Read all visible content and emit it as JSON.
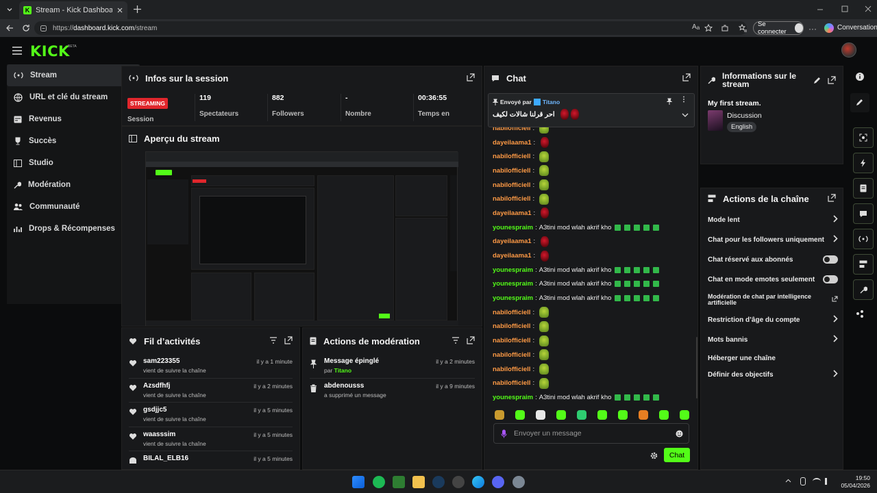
{
  "browser": {
    "tab_title": "Stream - Kick Dashboard",
    "url_scheme": "https://",
    "url_host": "dashboard.kick.com",
    "url_path": "/stream",
    "connect_label": "Se connecter",
    "conversation_label": "Conversation"
  },
  "brand": {
    "logo": "KICK",
    "tag": "BETA",
    "accent": "#53fc18"
  },
  "sidebar": {
    "items": [
      {
        "label": "Stream",
        "icon": "broadcast-icon"
      },
      {
        "label": "URL et clé du stream",
        "icon": "link-icon"
      },
      {
        "label": "Revenus",
        "icon": "wallet-icon"
      },
      {
        "label": "Succès",
        "icon": "trophy-icon"
      },
      {
        "label": "Studio",
        "icon": "studio-icon"
      },
      {
        "label": "Modération",
        "icon": "wrench-icon"
      },
      {
        "label": "Communauté",
        "icon": "community-icon"
      },
      {
        "label": "Drops & Récompenses",
        "icon": "chart-icon"
      }
    ]
  },
  "session": {
    "title": "Infos sur la session",
    "status_badge": "STREAMING",
    "status_label": "Session",
    "stats": [
      {
        "value": "119",
        "label": "Spectateurs"
      },
      {
        "value": "882",
        "label": "Followers"
      },
      {
        "value": "-",
        "label": "Nombre"
      },
      {
        "value": "00:36:55",
        "label": "Temps en"
      }
    ]
  },
  "preview": {
    "title": "Aperçu du stream"
  },
  "activity": {
    "title": "Fil d’activités",
    "items": [
      {
        "name": "sam223355",
        "sub": "vient de suivre la chaîne",
        "time": "il y a 1 minute"
      },
      {
        "name": "Azsdfhfj",
        "sub": "vient de suivre la chaîne",
        "time": "il y a 2 minutes"
      },
      {
        "name": "gsdjjc5",
        "sub": "vient de suivre la chaîne",
        "time": "il y a 5 minutes"
      },
      {
        "name": "waasssim",
        "sub": "vient de suivre la chaîne",
        "time": "il y a 5 minutes"
      },
      {
        "name": "BILAL_ELB16",
        "sub": "",
        "time": "il y a 5 minutes"
      }
    ]
  },
  "moderation": {
    "title": "Actions de modération",
    "items": [
      {
        "name": "Message épinglé",
        "sub_prefix": "par",
        "sub_user": "Titano",
        "time": "il y a 2 minutes"
      },
      {
        "name": "abdenousss",
        "sub_prefix": "a supprimé un message",
        "sub_user": "",
        "time": "il y a 9 minutes"
      }
    ]
  },
  "chat": {
    "title": "Chat",
    "pinned": {
      "sent_by": "Envoyé par",
      "user": "Titano",
      "text": "احر قرلنا شالات لكيف"
    },
    "messages": [
      {
        "user": "nabilofficiell",
        "color": "orange",
        "text": "",
        "emote": "pepe",
        "checks": 0
      },
      {
        "user": "dayeilaama1",
        "color": "orange",
        "text": "",
        "emote": "red",
        "checks": 0
      },
      {
        "user": "nabilofficiell",
        "color": "orange",
        "text": "",
        "emote": "pepe",
        "checks": 0
      },
      {
        "user": "nabilofficiell",
        "color": "orange",
        "text": "",
        "emote": "pepe",
        "checks": 0
      },
      {
        "user": "nabilofficiell",
        "color": "orange",
        "text": "",
        "emote": "pepe",
        "checks": 0
      },
      {
        "user": "nabilofficiell",
        "color": "orange",
        "text": "",
        "emote": "pepe",
        "checks": 0
      },
      {
        "user": "dayeilaama1",
        "color": "orange",
        "text": "",
        "emote": "red",
        "checks": 0
      },
      {
        "user": "younespraim",
        "color": "green",
        "text": "A3tini mod wlah akrif kho",
        "emote": "",
        "checks": 5
      },
      {
        "user": "dayeilaama1",
        "color": "orange",
        "text": "",
        "emote": "red",
        "checks": 0
      },
      {
        "user": "dayeilaama1",
        "color": "orange",
        "text": "",
        "emote": "red",
        "checks": 0
      },
      {
        "user": "younespraim",
        "color": "green",
        "text": "A3tini mod wlah akrif kho",
        "emote": "",
        "checks": 5
      },
      {
        "user": "younespraim",
        "color": "green",
        "text": "A3tini mod wlah akrif kho",
        "emote": "",
        "checks": 5
      },
      {
        "user": "younespraim",
        "color": "green",
        "text": "A3tini mod wlah akrif kho",
        "emote": "",
        "checks": 5
      },
      {
        "user": "nabilofficiell",
        "color": "orange",
        "text": "",
        "emote": "pepe",
        "checks": 0
      },
      {
        "user": "nabilofficiell",
        "color": "orange",
        "text": "",
        "emote": "pepe",
        "checks": 0
      },
      {
        "user": "nabilofficiell",
        "color": "orange",
        "text": "",
        "emote": "pepe",
        "checks": 0
      },
      {
        "user": "nabilofficiell",
        "color": "orange",
        "text": "",
        "emote": "pepe",
        "checks": 0
      },
      {
        "user": "nabilofficiell",
        "color": "orange",
        "text": "",
        "emote": "pepe",
        "checks": 0
      },
      {
        "user": "nabilofficiell",
        "color": "orange",
        "text": "",
        "emote": "pepe",
        "checks": 0
      },
      {
        "user": "younespraim",
        "color": "green",
        "text": "A3tini mod wlah akrif kho",
        "emote": "",
        "checks": 5
      }
    ],
    "input_placeholder": "Envoyer un message",
    "send_label": "Chat"
  },
  "stream_info": {
    "title": "Informations sur le stream",
    "stream_title": "My first stream.",
    "category": "Discussion",
    "language": "English"
  },
  "channel_actions": {
    "title": "Actions de la chaîne",
    "items": [
      {
        "label": "Mode lent",
        "control": "chevron"
      },
      {
        "label": "Chat pour les followers uniquement",
        "control": "chevron"
      },
      {
        "label": "Chat réservé aux abonnés",
        "control": "toggle"
      },
      {
        "label": "Chat en mode emotes seulement",
        "control": "toggle"
      },
      {
        "label": "Modération de chat par intelligence artificielle",
        "control": "external"
      },
      {
        "label": "Restriction d’âge du compte",
        "control": "chevron"
      },
      {
        "label": "Mots bannis",
        "control": "chevron"
      },
      {
        "label": "Héberger une chaîne",
        "control": "none"
      },
      {
        "label": "Définir des objectifs",
        "control": "chevron"
      }
    ]
  },
  "taskbar": {
    "time": "19:50",
    "date": "05/04/2026"
  }
}
